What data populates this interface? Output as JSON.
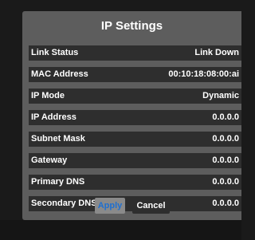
{
  "dialog": {
    "title": "IP Settings",
    "rows": [
      {
        "label": "Link Status",
        "value": "Link Down"
      },
      {
        "label": "MAC Address",
        "value": "00:10:18:08:00:ai"
      },
      {
        "label": "IP Mode",
        "value": "Dynamic"
      },
      {
        "label": "IP Address",
        "value": "0.0.0.0"
      },
      {
        "label": "Subnet Mask",
        "value": "0.0.0.0"
      },
      {
        "label": "Gateway",
        "value": "0.0.0.0"
      },
      {
        "label": "Primary DNS",
        "value": "0.0.0.0"
      },
      {
        "label": "Secondary DNS",
        "value": "0.0.0.0"
      }
    ],
    "buttons": {
      "apply_label": "Apply",
      "cancel_label": "Cancel"
    }
  },
  "colors": {
    "panel": "#5d5d5d",
    "row": "#2e2e2e",
    "apply_text": "#1e6fd0",
    "background": "#1a1a1a"
  }
}
